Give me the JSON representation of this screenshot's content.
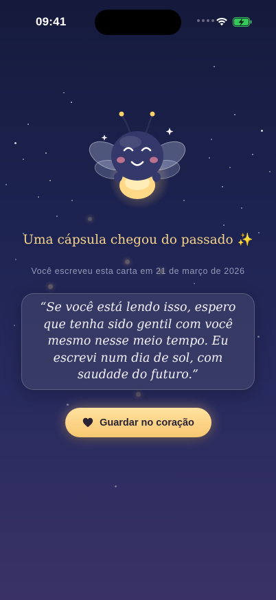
{
  "status_bar": {
    "time": "09:41"
  },
  "screen": {
    "title": "Uma cápsula chegou do passado ✨",
    "subtitle": "Você escreveu esta carta em 21 de março de 2026",
    "letter_text": "“Se você está lendo isso, espero que tenha sido gentil com você mesmo nesse meio tempo. Eu escrevi num dia de sol, com saudade do futuro.”",
    "button_label": "Guardar no coração",
    "button_icon": "heart-icon"
  },
  "colors": {
    "background_top": "#151a3c",
    "background_bottom": "#3a3266",
    "title": "#f6d58a",
    "button": "#f8c771",
    "battery": "#34c759"
  }
}
